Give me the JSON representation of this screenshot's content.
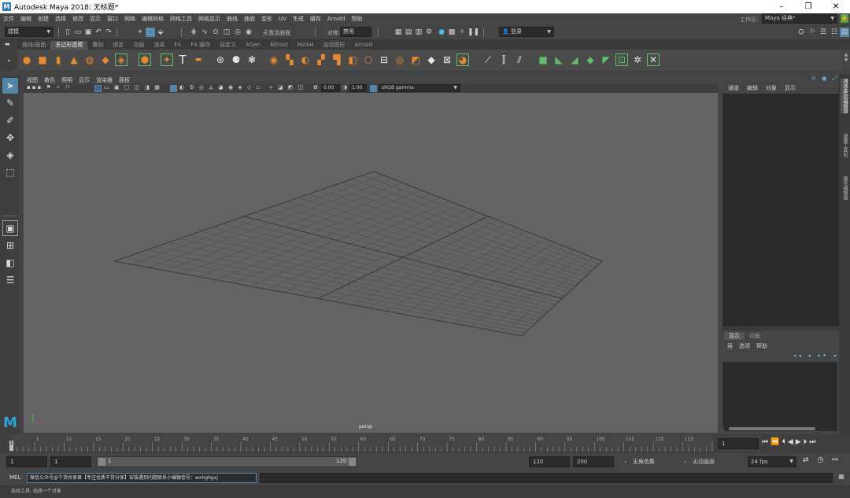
{
  "titlebar": {
    "title": "Autodesk Maya 2018: 无标题*",
    "minimize": "–",
    "restore": "❐",
    "close": "✕"
  },
  "menubar": {
    "items": [
      "文件",
      "编辑",
      "创建",
      "选择",
      "修改",
      "显示",
      "窗口",
      "网格",
      "编辑网格",
      "网格工具",
      "网格显示",
      "曲线",
      "曲面",
      "变形",
      "UV",
      "生成",
      "缓存",
      "Arnold",
      "帮助"
    ],
    "workspace_label": "工作区:",
    "workspace_value": "Maya 经典*"
  },
  "statusline": {
    "mode_value": "建模",
    "live_surface": "无激活曲面",
    "symmetry_label": "对称:",
    "symmetry_value": "禁用",
    "login_label": "登录"
  },
  "shelf": {
    "tabs": [
      "曲线/曲面",
      "多边形建模",
      "雕刻",
      "绑定",
      "动画",
      "渲染",
      "FX",
      "FX 缓存",
      "自定义",
      "XGen",
      "Bifrost",
      "MASH",
      "运动图形",
      "Arnold"
    ],
    "active_tab": "多边形建模"
  },
  "viewport": {
    "menus": [
      "视图",
      "着色",
      "照明",
      "显示",
      "渲染器",
      "面板"
    ],
    "exposure_value": "0.00",
    "gamma_value": "1.00",
    "color_space": "sRGB gamma",
    "camera_label": "persp"
  },
  "channelbox": {
    "menus": [
      "通道",
      "编辑",
      "对象",
      "显示"
    ]
  },
  "layer_editor": {
    "tabs": [
      "显示",
      "动画"
    ],
    "active_tab": "显示",
    "menus": [
      "层",
      "选项",
      "帮助"
    ]
  },
  "side_tabs": [
    "通道盒/层编辑器",
    "建模工具包",
    "属性编辑器"
  ],
  "timeslider": {
    "ticks": [
      "5",
      "10",
      "15",
      "20",
      "25",
      "30",
      "35",
      "40",
      "45",
      "50",
      "55",
      "60",
      "65",
      "70",
      "75",
      "80",
      "85",
      "90",
      "95",
      "100",
      "105",
      "110",
      "115",
      "12"
    ],
    "current_frame_marker": "1",
    "current_frame_field": "1"
  },
  "rangeslider": {
    "start_frame": "1",
    "playback_start": "1",
    "range_start_label": "1",
    "range_end_label": "120",
    "playback_end": "120",
    "end_frame": "200",
    "character_set": "无角色集",
    "anim_layer": "无动画层",
    "fps": "24 fps"
  },
  "cmdline": {
    "label": "MEL",
    "input_value": "微信公众号@千货共享君【专注优质干货分享】安装遇到问题联系小编微信号：wxhghgxj"
  },
  "helpline": {
    "text": "选择工具: 选择一个对象"
  },
  "colors": {
    "background": "#444444",
    "viewport": "#646464",
    "accent_orange": "#e88a2c",
    "accent_blue": "#2a7fc0",
    "accent_green": "#5fbf6d"
  }
}
